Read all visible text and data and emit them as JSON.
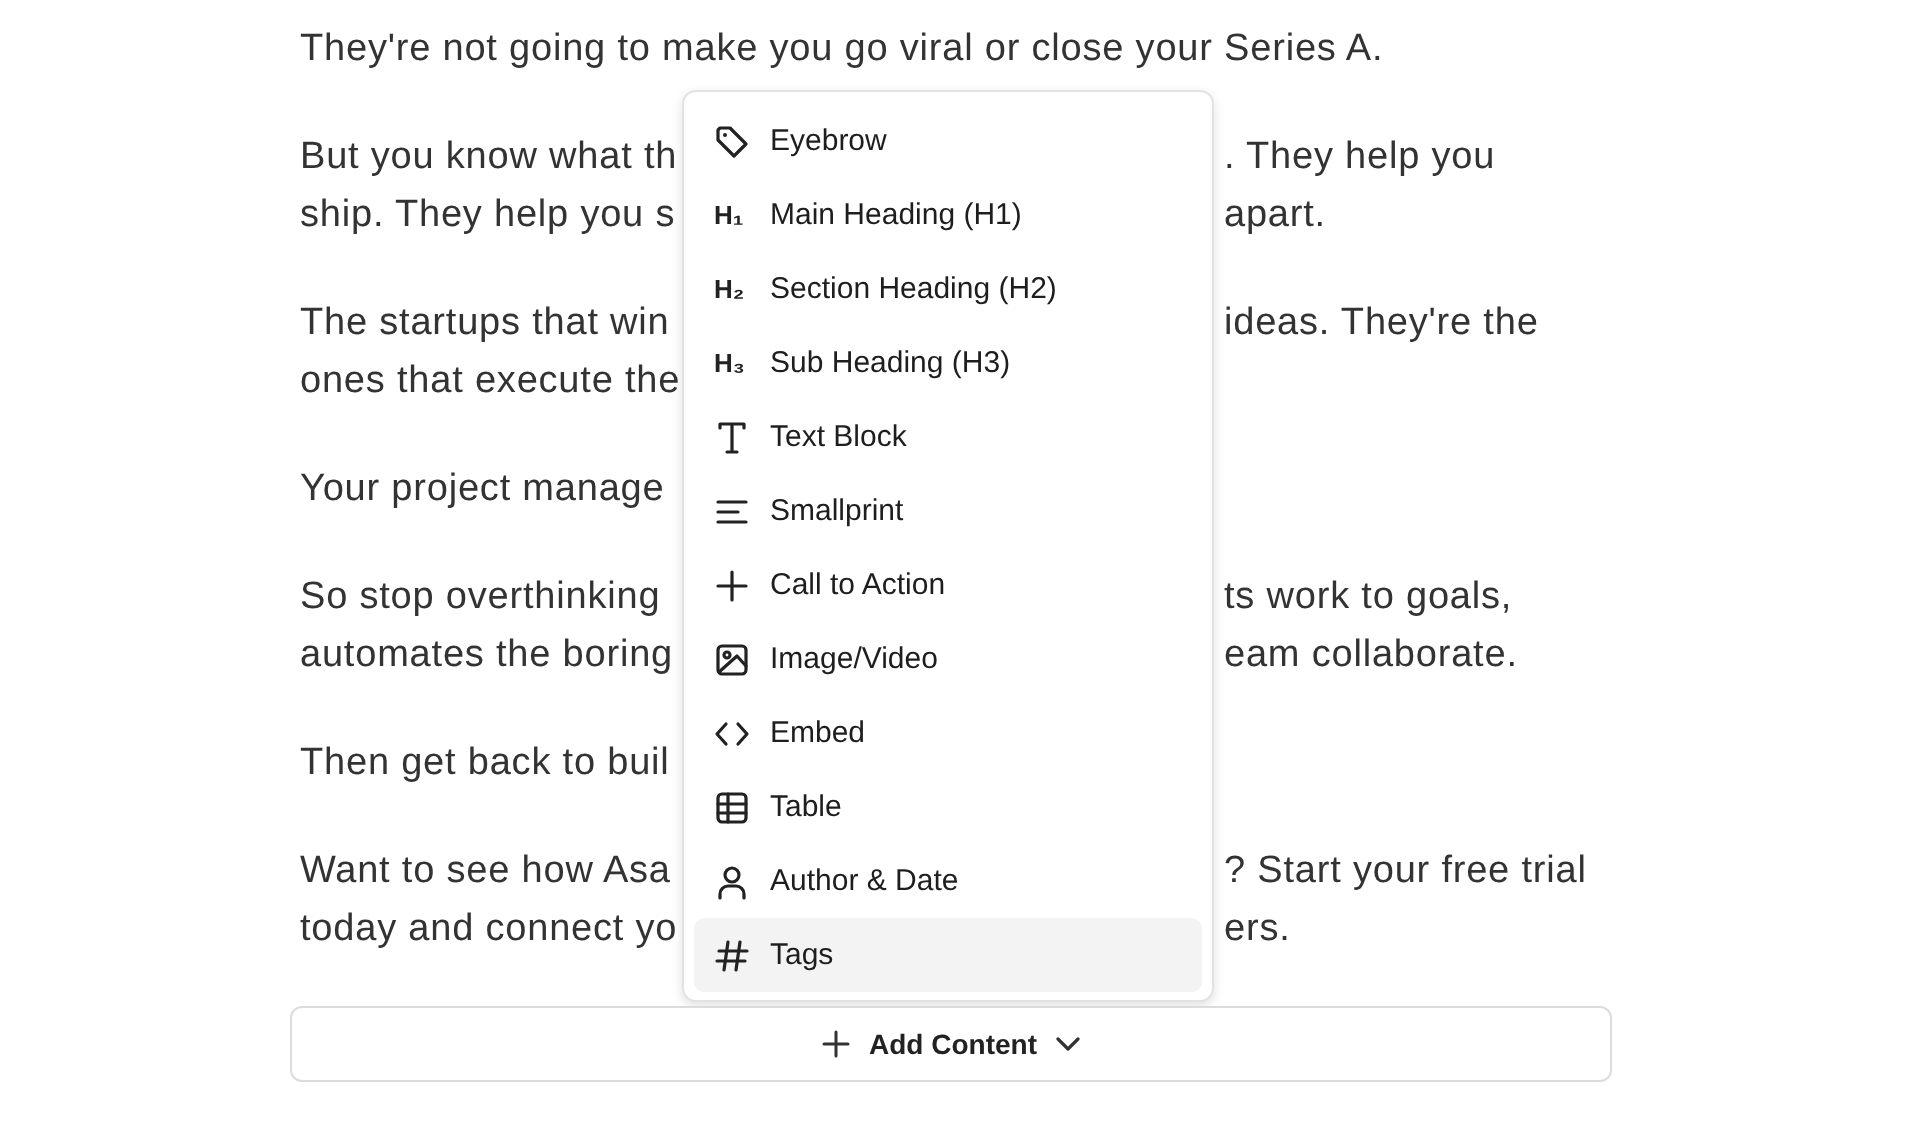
{
  "document": {
    "paragraphs": [
      {
        "lines": [
          {
            "left": "They're not going to make you go viral or close your Series A."
          }
        ]
      },
      {
        "lines": [
          {
            "left": "But you know what th",
            "right": ". They help you"
          },
          {
            "left": "ship. They help you s",
            "right": "apart."
          }
        ]
      },
      {
        "lines": [
          {
            "left": "The startups that win",
            "right": "ideas. They're the"
          },
          {
            "left": "ones that execute the"
          }
        ]
      },
      {
        "lines": [
          {
            "left": "Your project manage"
          }
        ]
      },
      {
        "lines": [
          {
            "left": "So stop overthinking",
            "right": "ts work to goals,"
          },
          {
            "left": "automates the boring",
            "right": "eam collaborate."
          }
        ]
      },
      {
        "lines": [
          {
            "left": "Then get back to buil"
          }
        ]
      },
      {
        "lines": [
          {
            "left": "Want to see how Asa",
            "right": "? Start your free trial"
          },
          {
            "left": "today and connect yo",
            "right": "ers."
          }
        ]
      }
    ]
  },
  "insert_menu": {
    "items": [
      {
        "label": "Eyebrow",
        "kind": "tag",
        "selected": false
      },
      {
        "label": "Main Heading (H1)",
        "kind": "glyph",
        "glyph": "H₁",
        "selected": false
      },
      {
        "label": "Section Heading (H2)",
        "kind": "glyph",
        "glyph": "H₂",
        "selected": false
      },
      {
        "label": "Sub Heading (H3)",
        "kind": "glyph",
        "glyph": "H₃",
        "selected": false
      },
      {
        "label": "Text Block",
        "kind": "type",
        "selected": false
      },
      {
        "label": "Smallprint",
        "kind": "lines",
        "selected": false
      },
      {
        "label": "Call to Action",
        "kind": "plus",
        "selected": false
      },
      {
        "label": "Image/Video",
        "kind": "image",
        "selected": false
      },
      {
        "label": "Embed",
        "kind": "code",
        "selected": false
      },
      {
        "label": "Table",
        "kind": "table",
        "selected": false
      },
      {
        "label": "Author & Date",
        "kind": "person",
        "selected": false
      },
      {
        "label": "Tags",
        "kind": "hash",
        "selected": true
      }
    ]
  },
  "add_button": {
    "label": "Add Content"
  }
}
